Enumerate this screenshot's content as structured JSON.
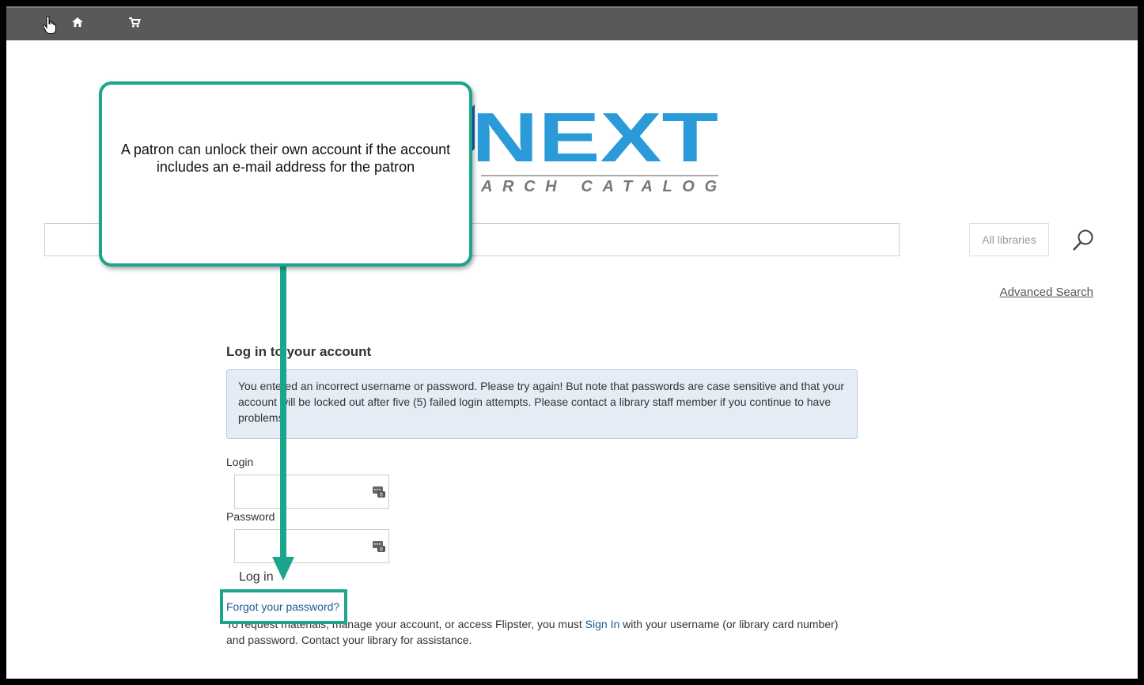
{
  "topbar": {
    "home_icon": "home-icon",
    "cart_icon": "cart-icon",
    "cursor_icon": "hand-pointer-icon"
  },
  "logo": {
    "main": "NEXT",
    "sub": "ARCH CATALOG",
    "colors": {
      "light_blue": "#2b9ad8",
      "dark_blue": "#1f5fae",
      "gray": "#777777"
    }
  },
  "search": {
    "library_select": "All libraries",
    "search_icon": "magnifier-icon",
    "advanced_label": "Advanced Search"
  },
  "login": {
    "title": "Log in to your account",
    "alert": "You entered an incorrect username or password. Please try again! But note that passwords are case sensitive and that your account will be locked out after five (5) failed login attempts. Please contact a library staff member if you continue to have problems.",
    "login_label": "Login",
    "password_label": "Password",
    "button_label": "Log in",
    "forgot_label": "Forgot your password?",
    "info_before": "To request materials, manage your account, or access Flipster, you must ",
    "info_link": "Sign In",
    "info_after": " with your username (or library card number) and password. Contact your library for assistance."
  },
  "callout": {
    "text": "A patron can unlock their own account if the account includes an e-mail address for the patron",
    "color": "#1aa58c"
  }
}
